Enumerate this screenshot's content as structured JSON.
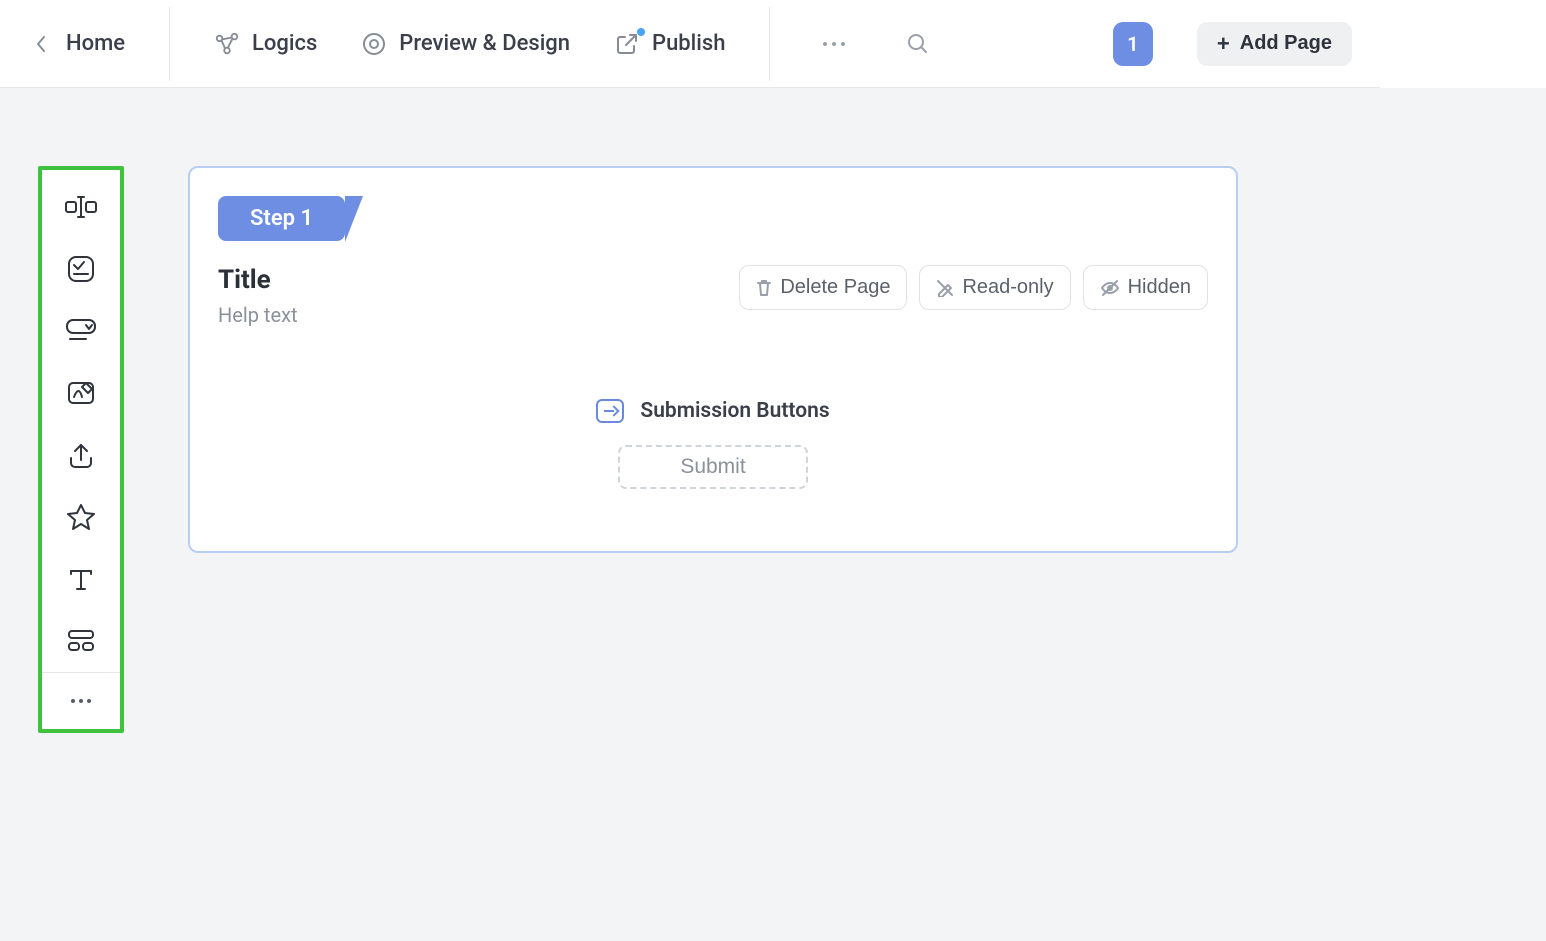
{
  "topbar": {
    "home": "Home",
    "logics": "Logics",
    "preview": "Preview & Design",
    "publish": "Publish",
    "pages": [
      "1"
    ],
    "add_page": "Add Page"
  },
  "tools": [
    {
      "id": "text-input",
      "label": "Text input"
    },
    {
      "id": "choice",
      "label": "Choice / checklist"
    },
    {
      "id": "dropdown",
      "label": "Dropdown"
    },
    {
      "id": "signature",
      "label": "Signature"
    },
    {
      "id": "upload",
      "label": "File upload"
    },
    {
      "id": "rating",
      "label": "Rating"
    },
    {
      "id": "text",
      "label": "Text"
    },
    {
      "id": "section",
      "label": "Section / layout"
    }
  ],
  "page": {
    "step_label": "Step 1",
    "title": "Title",
    "help": "Help text",
    "actions": {
      "delete": "Delete Page",
      "readonly": "Read-only",
      "hidden": "Hidden"
    },
    "submission_label": "Submission Buttons",
    "submit": "Submit"
  }
}
